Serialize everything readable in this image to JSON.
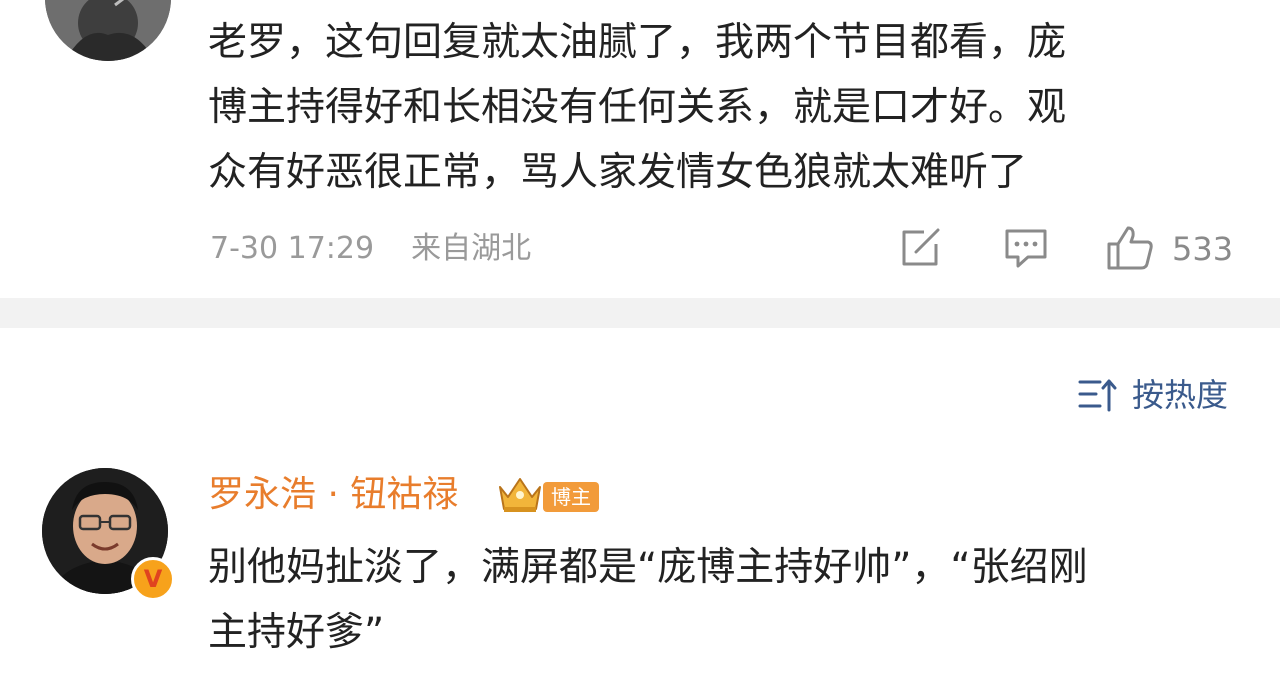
{
  "comment1": {
    "text_lines": [
      "老罗，这句回复就太油腻了，我两个节目都看，庞",
      "博主持得好和长相没有任何关系，就是口才好。观",
      "众有好恶很正常，骂人家发情女色狼就太难听了"
    ],
    "time": "7-30 17:29",
    "location": "来自湖北",
    "like_count": "533",
    "icons": [
      "edit-icon",
      "comment-icon",
      "like-icon"
    ]
  },
  "sort": {
    "label": "按热度",
    "icon": "sort-icon"
  },
  "comment2": {
    "username": "罗永浩 · 钮祜禄",
    "badge": "博主",
    "verified_mark": "V",
    "text_lines": [
      "别他妈扯淡了，满屏都是“庞博主持好帅”，“张绍刚",
      "主持好爹”"
    ]
  },
  "colors": {
    "username": "#e87d2c",
    "sort": "#3a5a8c",
    "meta": "#9a9a9a",
    "divider": "#f2f2f2",
    "badge": "#f29b3a"
  }
}
